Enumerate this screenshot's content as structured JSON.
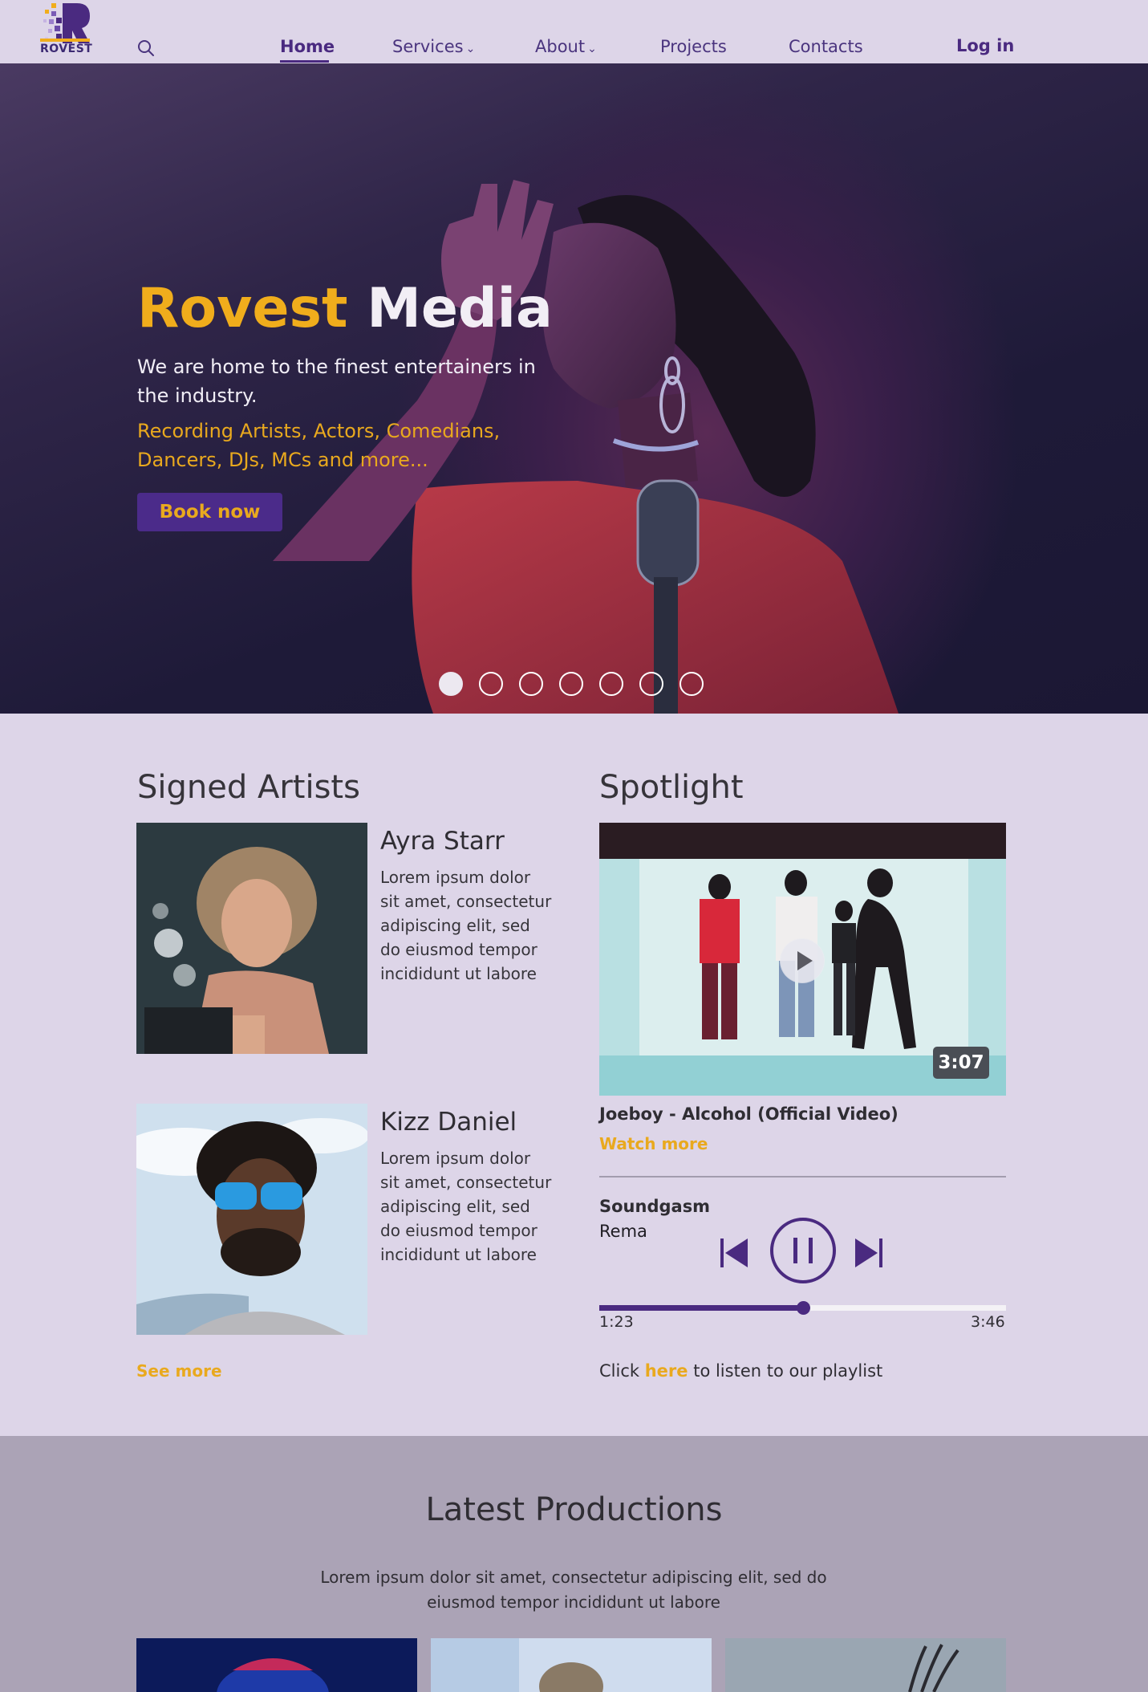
{
  "brand": {
    "logo_text": "ROVEST",
    "accent": "#f0ad1c",
    "primary": "#4a2a80",
    "background": "#ddd5e8"
  },
  "nav": {
    "search_icon": "search-icon",
    "links": [
      {
        "label": "Home",
        "active": true
      },
      {
        "label": "Services",
        "has_dropdown": true
      },
      {
        "label": "About",
        "has_dropdown": true
      },
      {
        "label": "Projects"
      },
      {
        "label": "Contacts"
      }
    ],
    "login": "Log in"
  },
  "hero": {
    "title_part1": "Rovest",
    "title_part2": "Media",
    "subtitle": "We are home to the finest entertainers in the industry.",
    "roles": "Recording Artists, Actors, Comedians, Dancers, DJs, MCs and more...",
    "cta": "Book now",
    "slides_total": 7,
    "active_slide": 1
  },
  "signed_artists": {
    "title": "Signed Artists",
    "artists": [
      {
        "name": "Ayra Starr",
        "bio": "Lorem ipsum dolor sit amet, consectetur adipiscing elit, sed do eiusmod tempor incididunt ut labore"
      },
      {
        "name": "Kizz Daniel",
        "bio": "Lorem ipsum dolor sit amet, consectetur adipiscing elit, sed do eiusmod tempor incididunt ut labore"
      }
    ],
    "see_more": "See more"
  },
  "spotlight": {
    "title": "Spotlight",
    "video": {
      "duration": "3:07",
      "title": "Joeboy - Alcohol (Official Video)",
      "watch_more": "Watch more"
    },
    "player": {
      "track": "Soundgasm",
      "artist": "Rema",
      "current_time": "1:23",
      "total_time": "3:46",
      "progress": 0.5
    },
    "playlist_prefix": "Click",
    "playlist_link": "here",
    "playlist_suffix": "to listen to our playlist"
  },
  "productions": {
    "title": "Latest Productions",
    "description": "Lorem ipsum dolor sit amet, consectetur adipiscing elit, sed do eiusmod tempor incididunt ut labore"
  }
}
